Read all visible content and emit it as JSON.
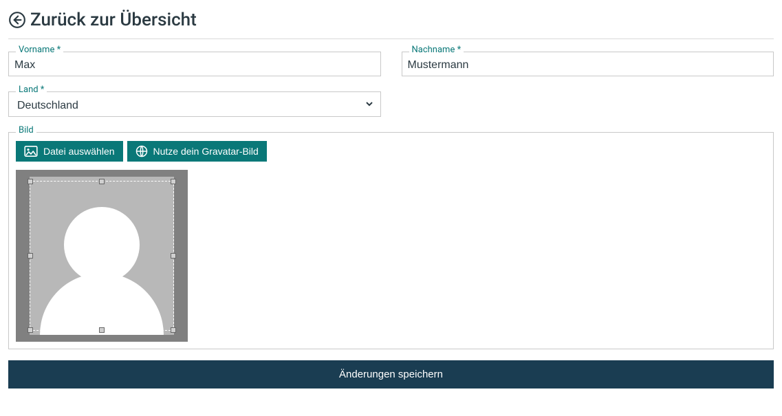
{
  "header": {
    "back_label": "Zurück zur Übersicht"
  },
  "form": {
    "firstname_label": "Vorname *",
    "firstname_value": "Max",
    "lastname_label": "Nachname *",
    "lastname_value": "Mustermann",
    "country_label": "Land *",
    "country_value": "Deutschland",
    "image_label": "Bild",
    "choose_file_label": "Datei auswählen",
    "gravatar_label": "Nutze dein Gravatar-Bild",
    "save_label": "Änderungen speichern"
  }
}
